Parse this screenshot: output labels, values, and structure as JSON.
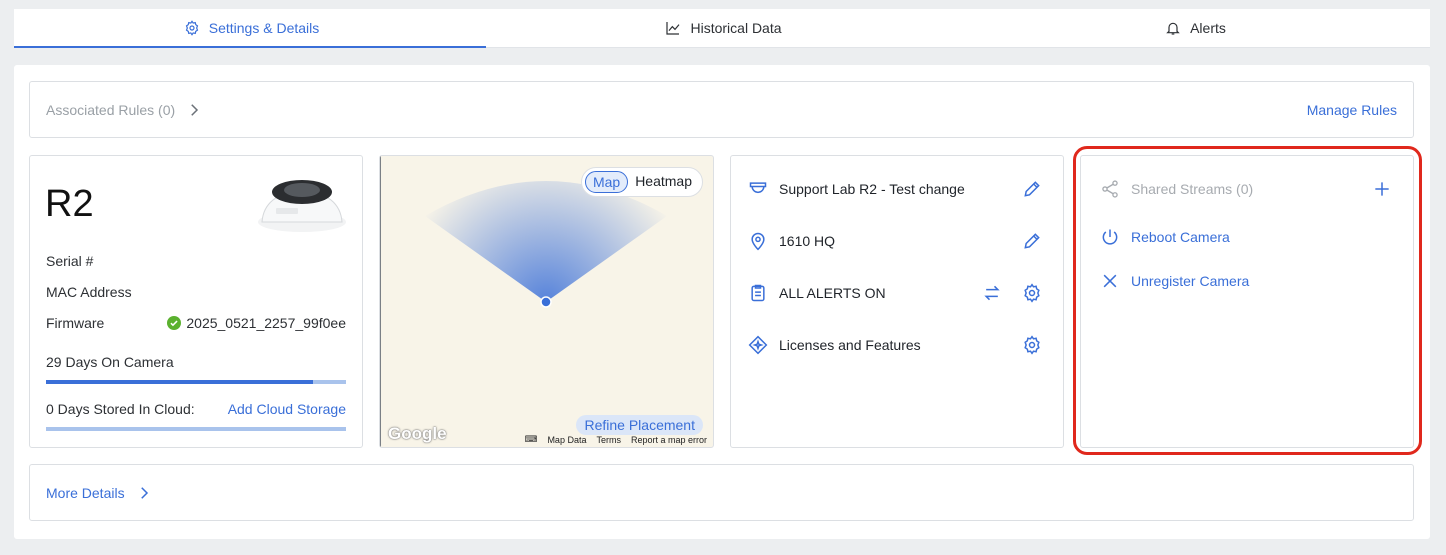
{
  "tabs": [
    {
      "label": "Settings & Details",
      "icon": "gear-icon"
    },
    {
      "label": "Historical Data",
      "icon": "chart-line-icon"
    },
    {
      "label": "Alerts",
      "icon": "bell-icon"
    }
  ],
  "rules": {
    "label": "Associated Rules (0)",
    "manage": "Manage Rules"
  },
  "camera": {
    "name": "R2",
    "serial_label": "Serial #",
    "mac_label": "MAC Address",
    "firmware_label": "Firmware",
    "firmware_value": "2025_0521_2257_99f0ee",
    "days_on_camera": "29 Days On Camera",
    "days_on_camera_fill": 0.89,
    "days_in_cloud": "0 Days Stored In Cloud:",
    "add_storage": "Add Cloud Storage"
  },
  "map": {
    "toggle_map": "Map",
    "toggle_heatmap": "Heatmap",
    "refine": "Refine Placement",
    "google": "Google",
    "attrib_data": "Map Data",
    "attrib_terms": "Terms",
    "attrib_report": "Report a map error"
  },
  "info": {
    "name": "Support Lab R2 - Test change",
    "location": "1610 HQ",
    "alerts": "ALL ALERTS ON",
    "licenses": "Licenses and Features"
  },
  "streams": {
    "shared": "Shared Streams (0)",
    "reboot": "Reboot Camera",
    "unregister": "Unregister Camera"
  },
  "more": {
    "label": "More Details"
  },
  "colors": {
    "accent": "#3a6fd8",
    "highlight": "#e0281c",
    "success": "#5bb12f"
  }
}
